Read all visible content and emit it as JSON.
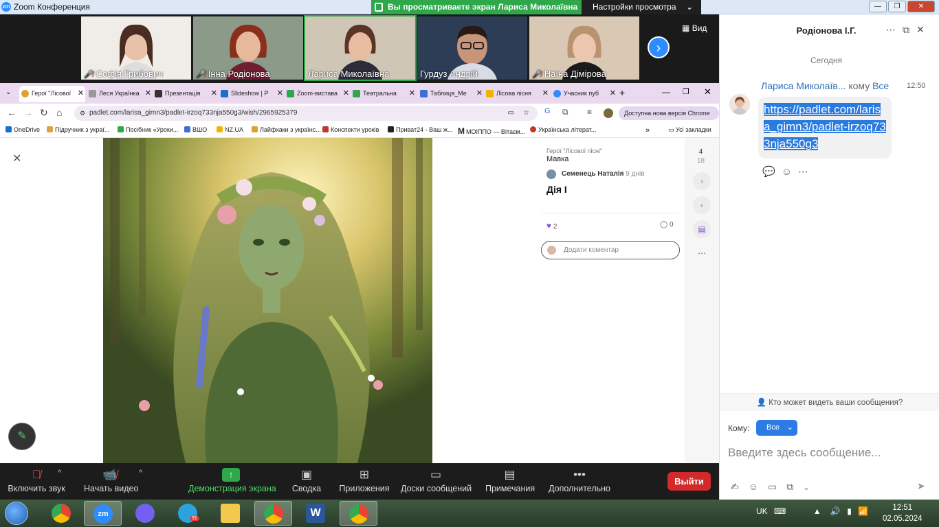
{
  "window": {
    "app_title": "Zoom Конференция",
    "share_banner": "Вы просматриваете экран Лариса Миколаївна",
    "view_settings": "Настройки просмотра",
    "view_label": "Вид"
  },
  "participants": [
    {
      "name": "Софія Грибович",
      "muted": true
    },
    {
      "name": "Інна Родіонова",
      "muted": true
    },
    {
      "name": "Лариса Миколаївна",
      "muted": false,
      "active": true
    },
    {
      "name": "Гурдуз Андрій",
      "muted": false
    },
    {
      "name": "Наїна Дімірова",
      "muted": true
    }
  ],
  "browser": {
    "tabs": [
      {
        "label": "Герої \"Лісової",
        "color": "#e0a030"
      },
      {
        "label": "Леся Українка",
        "color": "#888"
      },
      {
        "label": "Презентація",
        "color": "#333"
      },
      {
        "label": "Slideshow | P",
        "color": "#1c6fd1"
      },
      {
        "label": "Zoom-вистава",
        "color": "#2ea84a"
      },
      {
        "label": "Театральна",
        "color": "#2ea84a"
      },
      {
        "label": "Таблиця_Ме",
        "color": "#3b6fd4"
      },
      {
        "label": "Лісова пісня",
        "color": "#f2b400"
      },
      {
        "label": "Учасник пуб",
        "color": "#2d8cff"
      }
    ],
    "url": "padlet.com/larisa_gimn3/padlet-irzoq733nja550g3/wish/2965925379",
    "chrome_update": "Доступна нова версія Chrome",
    "bookmarks": [
      {
        "label": "OneDrive",
        "color": "#1c6fd1"
      },
      {
        "label": "Підручник з украї...",
        "color": "#d9a441"
      },
      {
        "label": "Посібник «Уроки...",
        "color": "#2ea84a"
      },
      {
        "label": "ВШО",
        "color": "#3b6fd4"
      },
      {
        "label": "NZ.UA",
        "color": "#f2b400"
      },
      {
        "label": "Лайфхаки з українс...",
        "color": "#e0a030"
      },
      {
        "label": "Конспекти уроків",
        "color": "#c0392b"
      },
      {
        "label": "Приват24 - Ваш ж...",
        "color": "#222"
      },
      {
        "label": "МОІППО — Вітаєм...",
        "color": "#111"
      },
      {
        "label": "Українська літерат...",
        "color": "#c0392b"
      }
    ],
    "all_bookmarks": "Усі закладки"
  },
  "padlet": {
    "crumb": "Герої \"Лісової пісні\"",
    "subsection": "Мавка",
    "author": "Семенець Наталія",
    "author_ago": "9 днів",
    "post_title": "Дія І",
    "likes": "2",
    "comments": "0",
    "add_comment_placeholder": "Додати коментар",
    "counter_current": "4",
    "counter_total": "18"
  },
  "toolbar": {
    "audio": "Включить звук",
    "video": "Начать видео",
    "share": "Демонстрация экрана",
    "summary": "Сводка",
    "apps": "Приложения",
    "whiteboards": "Доски сообщений",
    "notes": "Примечания",
    "more": "Дополнительно",
    "leave": "Выйти"
  },
  "chat": {
    "title": "Родіонова І.Г.",
    "day": "Сегодня",
    "sender": "Лариса Миколаїв...",
    "to_word": "кому",
    "to_all": "Все",
    "time": "12:50",
    "message": "https://padlet.com/larisa_gimn3/padlet-irzoq733nja550g3",
    "who_can_see": "Кто может видеть ваши сообщения?",
    "to_label": "Кому:",
    "to_value": "Все",
    "input_placeholder": "Введите здесь сообщение..."
  },
  "taskbar": {
    "language": "UK",
    "time": "12:51",
    "date": "02.05.2024",
    "telegram_badge": "91"
  }
}
